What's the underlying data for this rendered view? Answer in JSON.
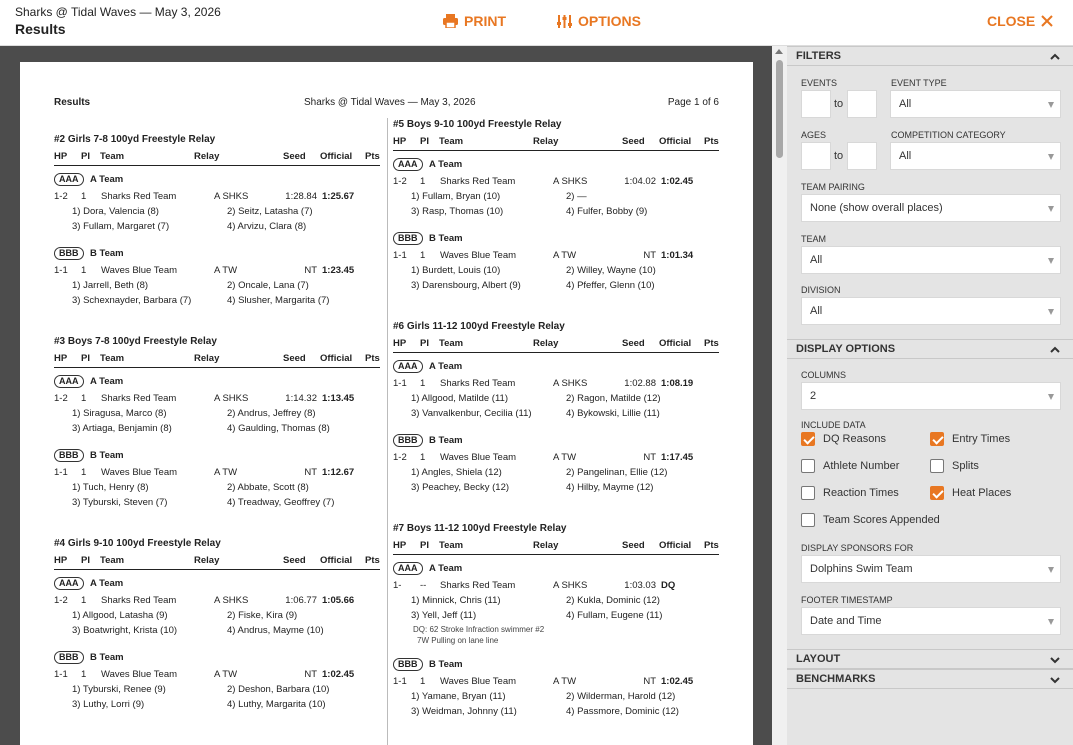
{
  "header": {
    "meet": "Sharks @ Tidal Waves — May 3, 2026",
    "title": "Results",
    "print": "PRINT",
    "options": "OPTIONS",
    "close": "CLOSE",
    "accent": "#e87722"
  },
  "paper": {
    "left": "Results",
    "center": "Sharks @ Tidal Waves — May 3, 2026",
    "right": "Page 1 of 6",
    "columns": [
      "HP",
      "PI",
      "Team",
      "Relay",
      "Seed",
      "Official",
      "Pts"
    ]
  },
  "left_events": [
    {
      "title": "#2 Girls 7-8 100yd Freestyle Relay",
      "teams": [
        {
          "badge": "AAA",
          "name": "A Team",
          "hp": "1-2",
          "pi": "1",
          "team": "Sharks Red Team",
          "relay": "A SHKS",
          "seed": "1:28.84",
          "official": "1:25.67",
          "s1": "1) Dora, Valencia (8)",
          "s2": "2) Seitz, Latasha (7)",
          "s3": "3) Fullam, Margaret (7)",
          "s4": "4) Arvizu, Clara (8)"
        },
        {
          "badge": "BBB",
          "name": "B Team",
          "hp": "1-1",
          "pi": "1",
          "team": "Waves Blue Team",
          "relay": "A TW",
          "seed": "NT",
          "official": "1:23.45",
          "s1": "1) Jarrell, Beth (8)",
          "s2": "2) Oncale, Lana (7)",
          "s3": "3) Schexnayder, Barbara (7)",
          "s4": "4) Slusher, Margarita (7)"
        }
      ]
    },
    {
      "title": "#3 Boys 7-8 100yd Freestyle Relay",
      "teams": [
        {
          "badge": "AAA",
          "name": "A Team",
          "hp": "1-2",
          "pi": "1",
          "team": "Sharks Red Team",
          "relay": "A SHKS",
          "seed": "1:14.32",
          "official": "1:13.45",
          "s1": "1) Siragusa, Marco (8)",
          "s2": "2) Andrus, Jeffrey (8)",
          "s3": "3) Artiaga, Benjamin (8)",
          "s4": "4) Gaulding, Thomas (8)"
        },
        {
          "badge": "BBB",
          "name": "B Team",
          "hp": "1-1",
          "pi": "1",
          "team": "Waves Blue Team",
          "relay": "A TW",
          "seed": "NT",
          "official": "1:12.67",
          "s1": "1) Tuch, Henry (8)",
          "s2": "2) Abbate, Scott (8)",
          "s3": "3) Tyburski, Steven (7)",
          "s4": "4) Treadway, Geoffrey (7)"
        }
      ]
    },
    {
      "title": "#4 Girls 9-10 100yd Freestyle Relay",
      "teams": [
        {
          "badge": "AAA",
          "name": "A Team",
          "hp": "1-2",
          "pi": "1",
          "team": "Sharks Red Team",
          "relay": "A SHKS",
          "seed": "1:06.77",
          "official": "1:05.66",
          "s1": "1) Allgood, Latasha (9)",
          "s2": "2) Fiske, Kira (9)",
          "s3": "3) Boatwright, Krista (10)",
          "s4": "4) Andrus, Mayme (10)"
        },
        {
          "badge": "BBB",
          "name": "B Team",
          "hp": "1-1",
          "pi": "1",
          "team": "Waves Blue Team",
          "relay": "A TW",
          "seed": "NT",
          "official": "1:02.45",
          "s1": "1) Tyburski, Renee (9)",
          "s2": "2) Deshon, Barbara (10)",
          "s3": "3) Luthy, Lorri (9)",
          "s4": "4) Luthy, Margarita (10)"
        }
      ]
    }
  ],
  "right_events": [
    {
      "title": "#5 Boys 9-10 100yd Freestyle Relay",
      "teams": [
        {
          "badge": "AAA",
          "name": "A Team",
          "hp": "1-2",
          "pi": "1",
          "team": "Sharks Red Team",
          "relay": "A SHKS",
          "seed": "1:04.02",
          "official": "1:02.45",
          "s1": "1) Fullam, Bryan (10)",
          "s2": "2) —",
          "s3": "3) Rasp, Thomas (10)",
          "s4": "4) Fulfer, Bobby (9)"
        },
        {
          "badge": "BBB",
          "name": "B Team",
          "hp": "1-1",
          "pi": "1",
          "team": "Waves Blue Team",
          "relay": "A TW",
          "seed": "NT",
          "official": "1:01.34",
          "s1": "1) Burdett, Louis (10)",
          "s2": "2) Willey, Wayne (10)",
          "s3": "3) Darensbourg, Albert (9)",
          "s4": "4) Pfeffer, Glenn (10)"
        }
      ]
    },
    {
      "title": "#6 Girls 11-12 100yd Freestyle Relay",
      "teams": [
        {
          "badge": "AAA",
          "name": "A Team",
          "hp": "1-1",
          "pi": "1",
          "team": "Sharks Red Team",
          "relay": "A SHKS",
          "seed": "1:02.88",
          "official": "1:08.19",
          "s1": "1) Allgood, Matilde (11)",
          "s2": "2) Ragon, Matilde (12)",
          "s3": "3) Vanvalkenbur, Cecilia (11)",
          "s4": "4) Bykowski, Lillie (11)"
        },
        {
          "badge": "BBB",
          "name": "B Team",
          "hp": "1-2",
          "pi": "1",
          "team": "Waves Blue Team",
          "relay": "A TW",
          "seed": "NT",
          "official": "1:17.45",
          "s1": "1) Angles, Shiela (12)",
          "s2": "2) Pangelinan, Ellie (12)",
          "s3": "3) Peachey, Becky (12)",
          "s4": "4) Hilby, Mayme (12)"
        }
      ]
    },
    {
      "title": "#7 Boys 11-12 100yd Freestyle Relay",
      "teams": [
        {
          "badge": "AAA",
          "name": "A Team",
          "hp": "1-",
          "pi": "--",
          "team": "Sharks Red Team",
          "relay": "A SHKS",
          "seed": "1:03.03",
          "official": "DQ",
          "s1": "1) Minnick, Chris (11)",
          "s2": "2) Kukla, Dominic (12)",
          "s3": "3) Yell, Jeff (11)",
          "s4": "4) Fullam, Eugene (11)",
          "dq1": "DQ: 62 Stroke Infraction swimmer #2",
          "dq2": "7W Pulling on lane line"
        },
        {
          "badge": "BBB",
          "name": "B Team",
          "hp": "1-1",
          "pi": "1",
          "team": "Waves Blue Team",
          "relay": "A TW",
          "seed": "NT",
          "official": "1:02.45",
          "s1": "1) Yamane, Bryan (11)",
          "s2": "2) Wilderman, Harold (12)",
          "s3": "3) Weidman, Johnny (11)",
          "s4": "4) Passmore, Dominic (12)"
        }
      ]
    }
  ],
  "panel": {
    "filters": "FILTERS",
    "events_label": "EVENTS",
    "to": "to",
    "event_type_label": "EVENT TYPE",
    "event_type": "All",
    "ages_label": "AGES",
    "comp_cat_label": "COMPETITION CATEGORY",
    "comp_cat": "All",
    "pairing_label": "TEAM PAIRING",
    "pairing": "None (show overall places)",
    "team_label": "TEAM",
    "team": "All",
    "division_label": "DIVISION",
    "division": "All",
    "display_options": "DISPLAY OPTIONS",
    "columns_label": "COLUMNS",
    "columns": "2",
    "include_label": "INCLUDE DATA",
    "checks": [
      {
        "label": "DQ Reasons",
        "checked": true
      },
      {
        "label": "Entry Times",
        "checked": true
      },
      {
        "label": "Athlete Number",
        "checked": false
      },
      {
        "label": "Splits",
        "checked": false
      },
      {
        "label": "Reaction Times",
        "checked": false
      },
      {
        "label": "Heat Places",
        "checked": true
      },
      {
        "label": "Team Scores Appended",
        "checked": false
      }
    ],
    "sponsors_label": "DISPLAY SPONSORS FOR",
    "sponsors": "Dolphins Swim Team",
    "footer_label": "FOOTER TIMESTAMP",
    "footer": "Date and Time",
    "layout": "LAYOUT",
    "benchmarks": "BENCHMARKS"
  }
}
